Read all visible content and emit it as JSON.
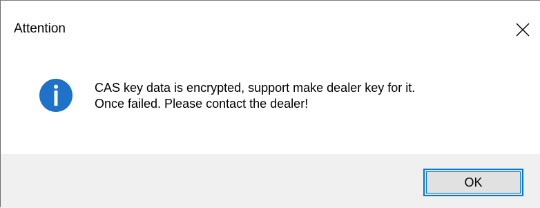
{
  "dialog": {
    "title": "Attention",
    "icon": "info-icon",
    "message_lines": [
      "CAS key data is encrypted, support make dealer key for it.",
      "Once failed. Please contact the dealer!"
    ],
    "ok_label": "OK",
    "close_icon": "close-icon"
  },
  "colors": {
    "icon_blue": "#1a6fc4",
    "button_border": "#0078d7",
    "button_bg": "#e1e1e1",
    "footer_bg": "#f0f0f0"
  }
}
